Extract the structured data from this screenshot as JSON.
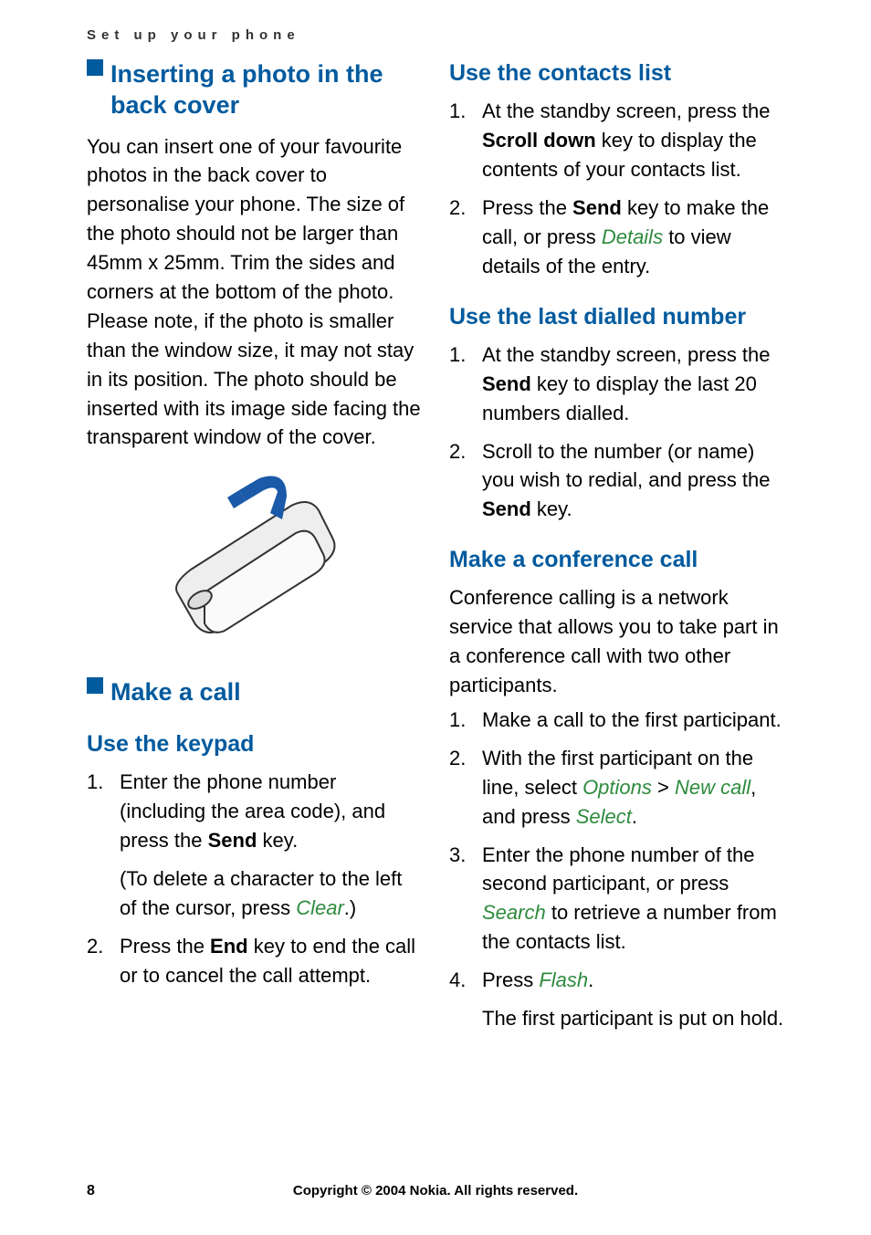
{
  "header": "Set up your phone",
  "left": {
    "sec1": {
      "title": "Inserting a photo in the back cover",
      "body": "You can insert one of your favourite photos in the back cover to personalise your phone. The size of the photo should not be larger than 45mm x 25mm. Trim the sides and corners at the bottom of the photo. Please note, if the photo is smaller than the window size, it may not stay in its position. The photo should be inserted with its image side facing the transparent window of the cover."
    },
    "sec2": {
      "title": "Make a call",
      "sub1": {
        "title": "Use the keypad",
        "li1_a": "Enter the phone number (including the area code), and press the ",
        "li1_send": "Send",
        "li1_b": " key.",
        "li1_c": "(To delete a character to the left of the cursor, press ",
        "li1_clear": "Clear",
        "li1_d": ".)",
        "li2_a": "Press the ",
        "li2_end": "End",
        "li2_b": " key to end the call or to cancel the call attempt."
      }
    }
  },
  "right": {
    "sub1": {
      "title": "Use the contacts list",
      "li1_a": "At the standby screen, press the ",
      "li1_scroll": "Scroll down",
      "li1_b": " key to display the contents of your contacts list.",
      "li2_a": "Press the ",
      "li2_send": "Send",
      "li2_b": " key to make the call, or press ",
      "li2_details": "Details",
      "li2_c": " to view details of the entry."
    },
    "sub2": {
      "title": "Use the last dialled number",
      "li1_a": "At the standby screen, press the ",
      "li1_send": "Send",
      "li1_b": " key to display the last 20 numbers dialled.",
      "li2_a": "Scroll to the number (or name) you wish to redial, and press the ",
      "li2_send": "Send",
      "li2_b": " key."
    },
    "sub3": {
      "title": "Make a conference call",
      "body": "Conference calling is a network service that allows you to take part in a conference call with two other participants.",
      "li1": "Make a call to the first participant.",
      "li2_a": "With the first participant on the line, select ",
      "li2_options": "Options",
      "li2_gt": " > ",
      "li2_newcall": "New call",
      "li2_b": ", and press ",
      "li2_select": "Select",
      "li2_c": ".",
      "li3_a": "Enter the phone number of the second participant, or press ",
      "li3_search": "Search",
      "li3_b": " to retrieve a number from the contacts list.",
      "li4_a": "Press ",
      "li4_flash": "Flash",
      "li4_b": ".",
      "li4_sub": "The first participant is put on hold."
    }
  },
  "footer": {
    "page": "8",
    "copyright": "Copyright © 2004 Nokia. All rights reserved."
  }
}
